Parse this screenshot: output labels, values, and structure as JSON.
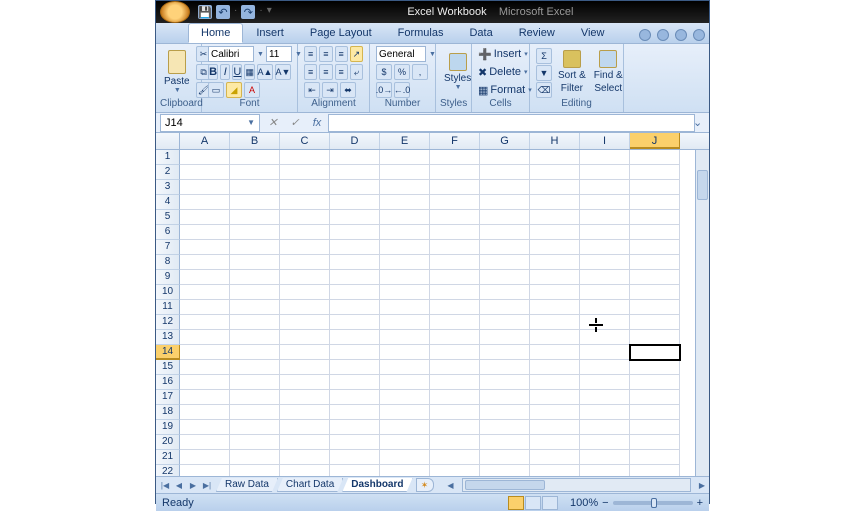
{
  "title": {
    "doc": "Excel Workbook",
    "app": "Microsoft Excel"
  },
  "tabs": [
    "Home",
    "Insert",
    "Page Layout",
    "Formulas",
    "Data",
    "Review",
    "View"
  ],
  "active_tab": "Home",
  "ribbon": {
    "clipboard": {
      "paste": "Paste",
      "label": "Clipboard"
    },
    "font": {
      "name": "Calibri",
      "size": "11",
      "label": "Font"
    },
    "alignment": {
      "label": "Alignment"
    },
    "number": {
      "format": "General",
      "label": "Number"
    },
    "styles": {
      "styles": "Styles",
      "label": "Styles"
    },
    "cells": {
      "insert": "Insert",
      "delete": "Delete",
      "format": "Format",
      "label": "Cells"
    },
    "editing": {
      "sort_filter_l1": "Sort &",
      "sort_filter_l2": "Filter",
      "find_select_l1": "Find &",
      "find_select_l2": "Select",
      "label": "Editing"
    }
  },
  "name_box": "J14",
  "columns": [
    "A",
    "B",
    "C",
    "D",
    "E",
    "F",
    "G",
    "H",
    "I",
    "J"
  ],
  "active_col_index": 9,
  "rows": [
    1,
    2,
    3,
    4,
    5,
    6,
    7,
    8,
    9,
    10,
    11,
    12,
    13,
    14,
    15,
    16,
    17,
    18,
    19,
    20,
    21,
    22
  ],
  "active_row": 14,
  "sheet_tabs": [
    "Raw Data",
    "Chart Data",
    "Dashboard"
  ],
  "active_sheet": "Dashboard",
  "status": {
    "ready": "Ready",
    "zoom": "100%"
  }
}
